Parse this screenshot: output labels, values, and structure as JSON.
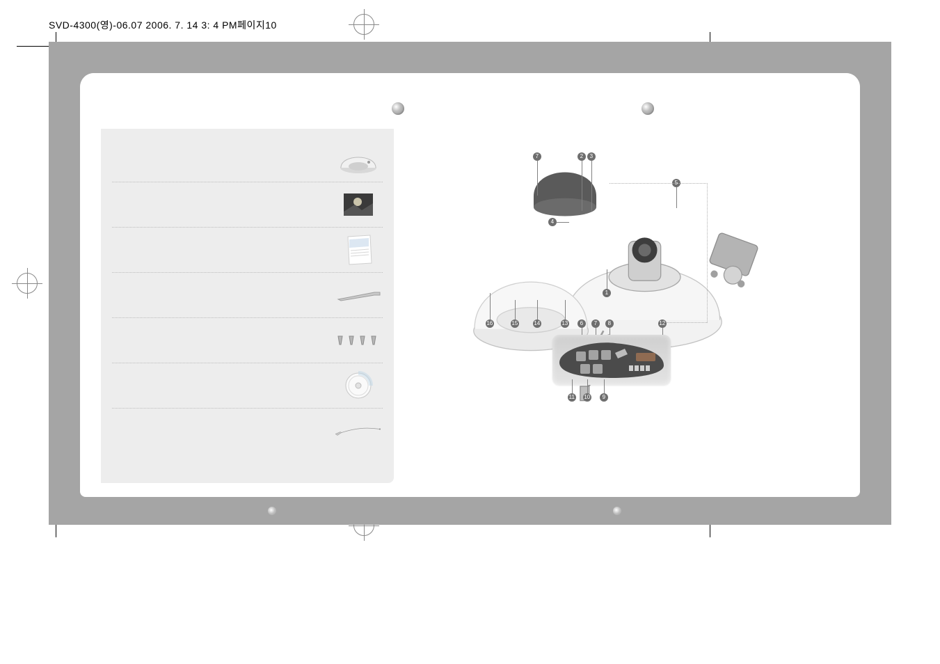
{
  "doc_header": "SVD-4300(영)-06.07  2006. 7. 14 3: 4 PM페이지10",
  "package_items": [
    {
      "label": "",
      "icon": "dome-camera"
    },
    {
      "label": "",
      "icon": "photo-sample"
    },
    {
      "label": "",
      "icon": "manual-sheet"
    },
    {
      "label": "",
      "icon": "hex-wrench"
    },
    {
      "label": "",
      "icon": "screws-4"
    },
    {
      "label": "",
      "icon": "cd-disc"
    },
    {
      "label": "",
      "icon": "test-cable"
    }
  ],
  "callouts_top": [
    "7",
    "2",
    "3"
  ],
  "callout_center": "4",
  "callout_right": "5",
  "callout_base": "1",
  "callouts_bottom_row1": [
    "16",
    "15",
    "14",
    "13",
    "6",
    "7",
    "8"
  ],
  "callout_near_pcb": "12",
  "callouts_below_pcb": [
    "11",
    "10",
    "9"
  ]
}
